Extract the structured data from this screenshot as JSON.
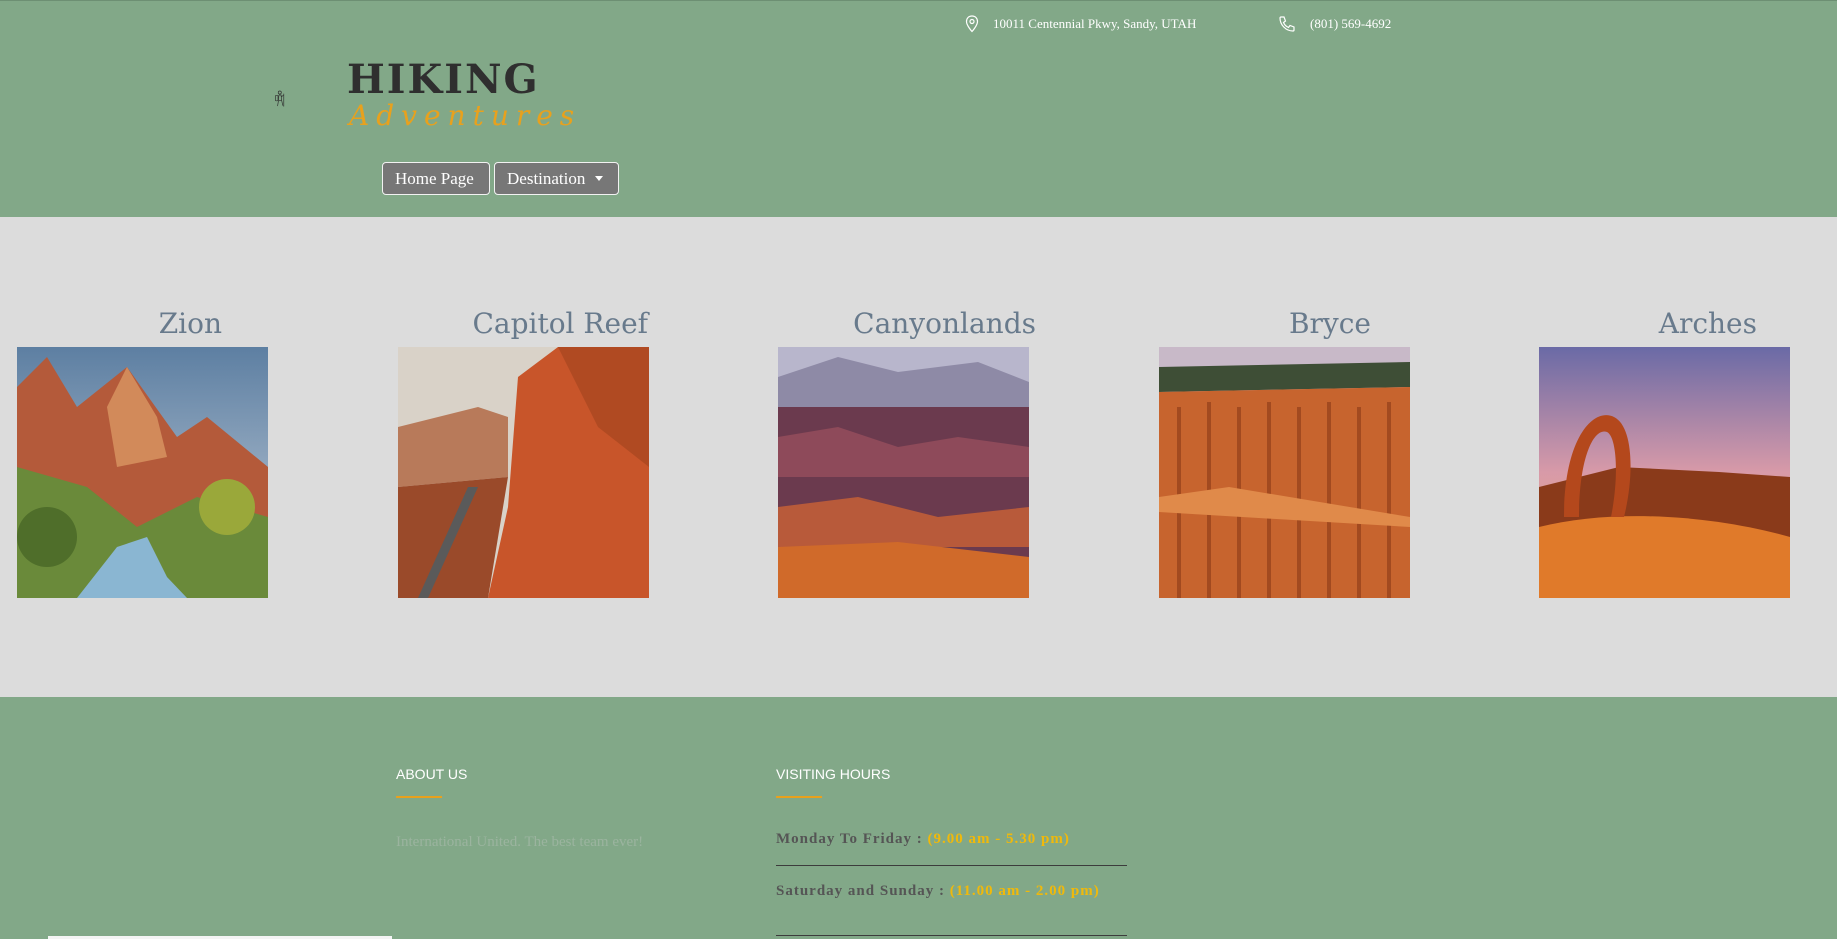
{
  "header": {
    "address": "10011 Centennial Pkwy, Sandy, UTAH",
    "phone": "(801) 569-4692",
    "logo_title": "HIKING",
    "logo_subtitle": "Adventures"
  },
  "nav": {
    "home_label": "Home Page",
    "destination_label": "Destination"
  },
  "destinations": [
    {
      "name": "Zion"
    },
    {
      "name": "Capitol Reef"
    },
    {
      "name": "Canyonlands"
    },
    {
      "name": "Bryce"
    },
    {
      "name": "Arches"
    }
  ],
  "footer": {
    "about_heading": "ABOUT US",
    "about_text": "International United. The best team ever!",
    "hours_heading": "VISITING HOURS",
    "hours": [
      {
        "days": "Monday To Friday :",
        "time": "(9.00 am - 5.30 pm)"
      },
      {
        "days": "Saturday and Sunday :",
        "time": "(11.00 am - 2.00 pm)"
      }
    ]
  },
  "colors": {
    "brand_green": "#82a888",
    "accent_orange": "#e8a11d",
    "hours_yellow": "#f0b90b",
    "title_slate": "#687a8c"
  }
}
